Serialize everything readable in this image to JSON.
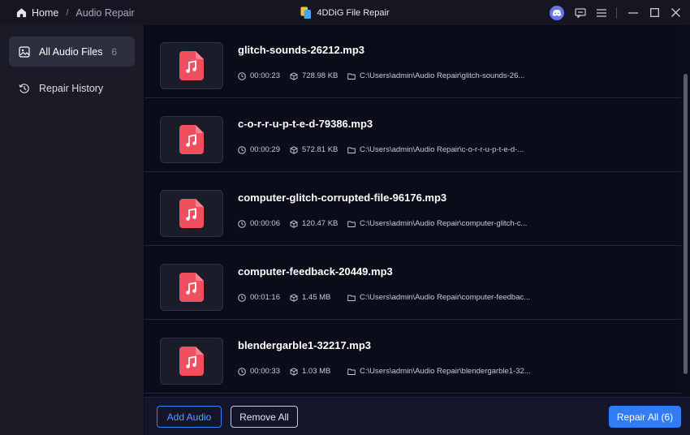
{
  "titlebar": {
    "home_label": "Home",
    "separator": "/",
    "current_label": "Audio Repair",
    "app_title": "4DDiG File Repair"
  },
  "sidebar": {
    "items": [
      {
        "label": "All Audio Files",
        "count": "6",
        "icon": "image-icon",
        "active": true
      },
      {
        "label": "Repair History",
        "icon": "history-icon",
        "active": false
      }
    ]
  },
  "files": [
    {
      "name": "glitch-sounds-26212.mp3",
      "duration": "00:00:23",
      "size": "728.98 KB",
      "path": "C:\\Users\\admin\\Audio Repair\\glitch-sounds-26..."
    },
    {
      "name": "c-o-r-r-u-p-t-e-d-79386.mp3",
      "duration": "00:00:29",
      "size": "572.81 KB",
      "path": "C:\\Users\\admin\\Audio Repair\\c-o-r-r-u-p-t-e-d-..."
    },
    {
      "name": "computer-glitch-corrupted-file-96176.mp3",
      "duration": "00:00:06",
      "size": "120.47 KB",
      "path": "C:\\Users\\admin\\Audio Repair\\computer-glitch-c..."
    },
    {
      "name": "computer-feedback-20449.mp3",
      "duration": "00:01:16",
      "size": "1.45 MB",
      "path": "C:\\Users\\admin\\Audio Repair\\computer-feedbac..."
    },
    {
      "name": "blendergarble1-32217.mp3",
      "duration": "00:00:33",
      "size": "1.03 MB",
      "path": "C:\\Users\\admin\\Audio Repair\\blendergarble1-32..."
    }
  ],
  "footer": {
    "add_label": "Add Audio",
    "remove_label": "Remove All",
    "repair_label": "Repair All (6)"
  },
  "colors": {
    "accent": "#2f7cf6",
    "file_icon": "#f0505e",
    "background": "#0b0c1a",
    "sidebar": "#1a1b27"
  }
}
